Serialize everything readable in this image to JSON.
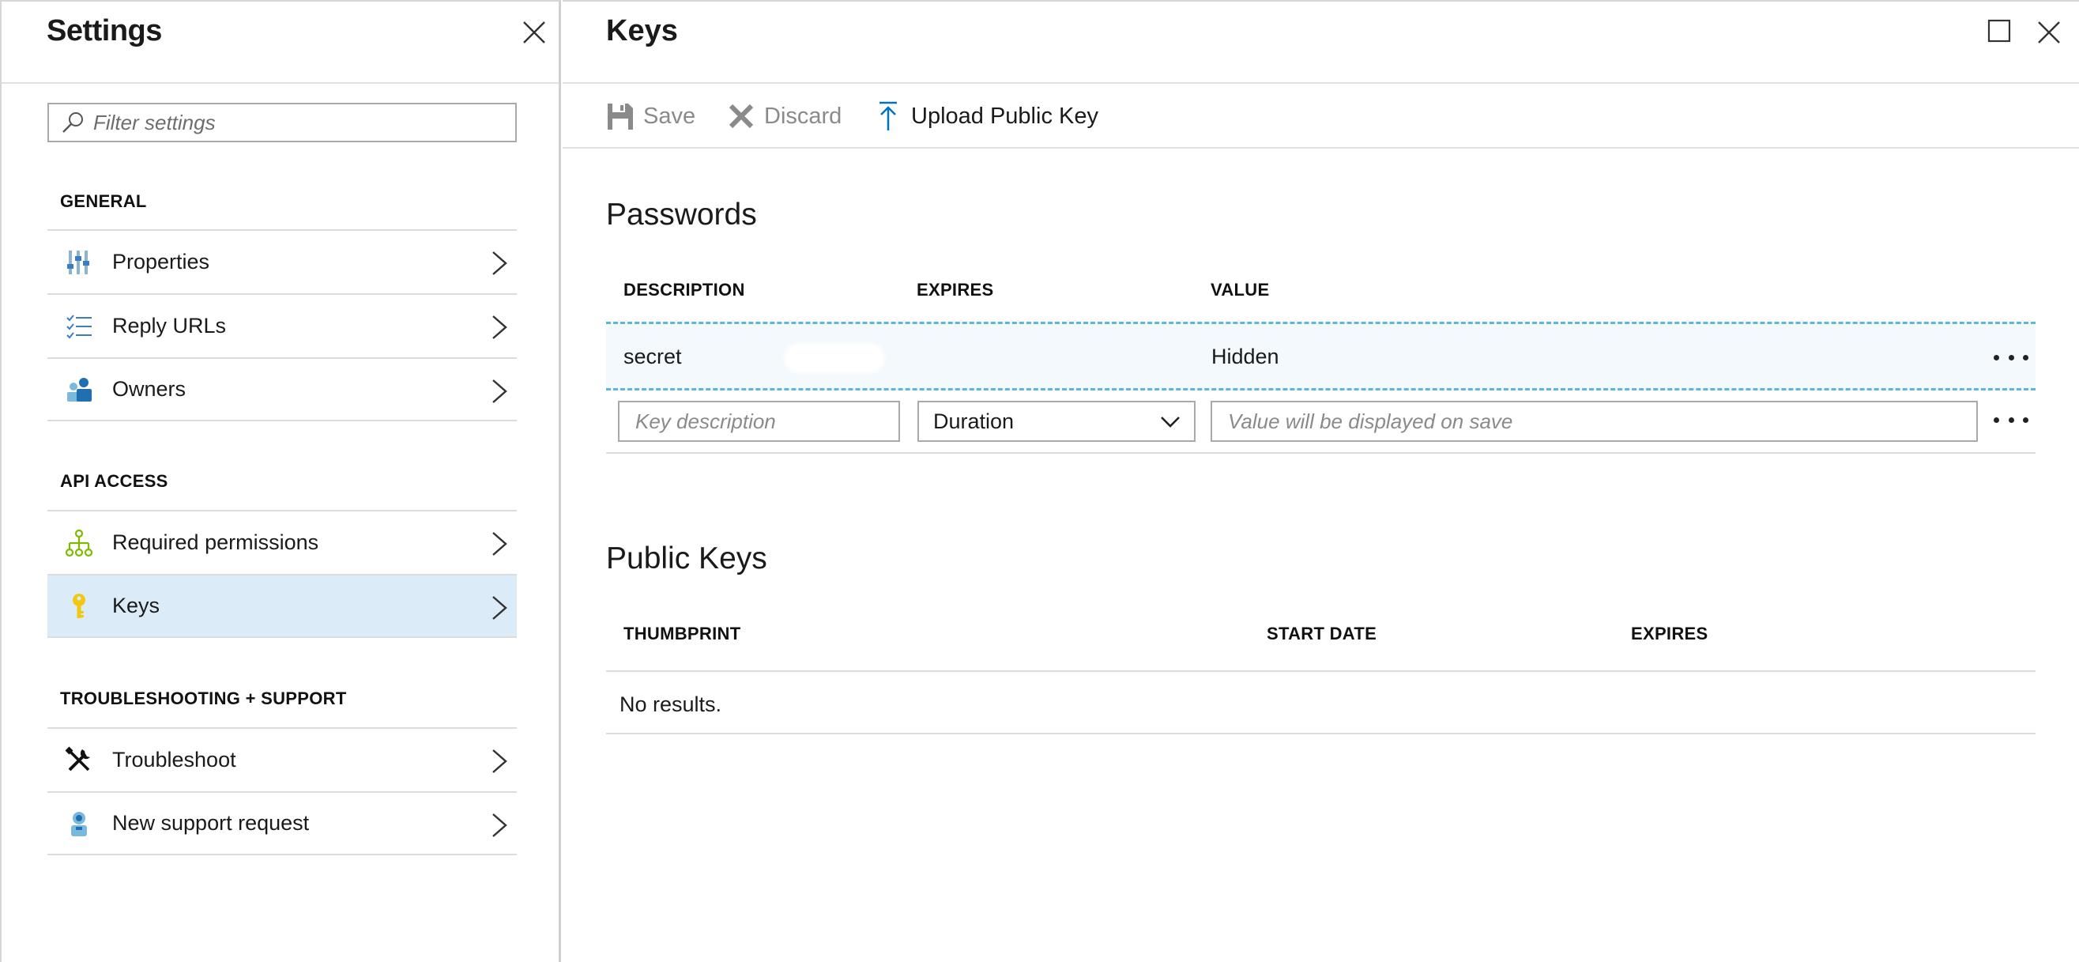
{
  "settings": {
    "title": "Settings",
    "filter_placeholder": "Filter settings",
    "sections": {
      "general": {
        "label": "GENERAL",
        "items": [
          {
            "label": "Properties",
            "icon": "properties-icon"
          },
          {
            "label": "Reply URLs",
            "icon": "reply-urls-icon"
          },
          {
            "label": "Owners",
            "icon": "owners-icon"
          }
        ]
      },
      "api_access": {
        "label": "API ACCESS",
        "items": [
          {
            "label": "Required permissions",
            "icon": "permissions-icon"
          },
          {
            "label": "Keys",
            "icon": "key-icon",
            "active": true
          }
        ]
      },
      "troubleshooting": {
        "label": "TROUBLESHOOTING + SUPPORT",
        "items": [
          {
            "label": "Troubleshoot",
            "icon": "tools-icon"
          },
          {
            "label": "New support request",
            "icon": "support-icon"
          }
        ]
      }
    }
  },
  "keys": {
    "title": "Keys",
    "toolbar": {
      "save_label": "Save",
      "discard_label": "Discard",
      "upload_label": "Upload Public Key"
    },
    "passwords": {
      "heading": "Passwords",
      "columns": [
        "DESCRIPTION",
        "EXPIRES",
        "VALUE"
      ],
      "rows": [
        {
          "description": "secret",
          "expires": "",
          "value": "Hidden"
        }
      ],
      "new_row": {
        "description_placeholder": "Key description",
        "duration_value": "Duration",
        "value_placeholder": "Value will be displayed on save"
      }
    },
    "public_keys": {
      "heading": "Public Keys",
      "columns": [
        "THUMBPRINT",
        "START DATE",
        "EXPIRES"
      ],
      "empty_text": "No results."
    }
  },
  "colors": {
    "accent": "#0072c6",
    "active_bg": "#dcebf8",
    "row_highlight_border": "#5cb8d6",
    "key_icon": "#f2c811",
    "permissions_icon": "#7fba00"
  }
}
